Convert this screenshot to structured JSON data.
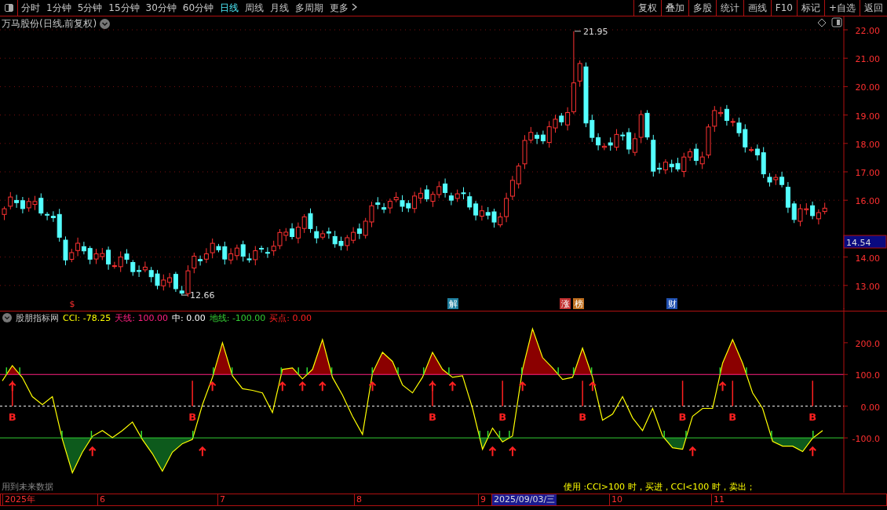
{
  "toolbar": {
    "periods": [
      {
        "label": "分时",
        "selected": false
      },
      {
        "label": "1分钟",
        "selected": false
      },
      {
        "label": "5分钟",
        "selected": false
      },
      {
        "label": "15分钟",
        "selected": false
      },
      {
        "label": "30分钟",
        "selected": false
      },
      {
        "label": "60分钟",
        "selected": false
      },
      {
        "label": "日线",
        "selected": true
      },
      {
        "label": "周线",
        "selected": false
      },
      {
        "label": "月线",
        "selected": false
      },
      {
        "label": "多周期",
        "selected": false
      },
      {
        "label": "更多",
        "selected": false
      }
    ],
    "buttons": [
      "复权",
      "叠加",
      "多股",
      "统计",
      "画线",
      "F10",
      "标记",
      "+自选",
      "返回"
    ]
  },
  "price_panel": {
    "title": "万马股份(日线,前复权)",
    "high_label": "21.95",
    "low_label": "12.66",
    "events": [
      {
        "text": "$"
      },
      {
        "text": "解",
        "color": "#1f7f9f"
      },
      {
        "text": "涨",
        "color": "#c03030"
      },
      {
        "text": "榜",
        "color": "#c07020"
      },
      {
        "text": "财",
        "color": "#2050b0"
      }
    ],
    "axis_labels": [
      "22.00",
      "21.00",
      "20.00",
      "19.00",
      "18.00",
      "17.00",
      "16.00",
      "14.00",
      "13.00"
    ],
    "last_price": "14.54"
  },
  "indicator_panel": {
    "name": "股朋指标网",
    "legend": [
      {
        "label": "CCI: -78.25",
        "color": "#ffff00"
      },
      {
        "label": "天线: 100.00",
        "color": "#ff2080"
      },
      {
        "label": "中: 0.00",
        "color": "#ffffff"
      },
      {
        "label": "地线: -100.00",
        "color": "#33cc33"
      },
      {
        "label": "买点: 0.00",
        "color": "#ff2020"
      }
    ],
    "axis_labels": [
      "200.0",
      "100.0",
      "0.00",
      "-100.0"
    ],
    "signal_labels": [
      "B",
      "B",
      "B",
      "B",
      "B",
      "B",
      "B",
      "B"
    ],
    "note": "用到未来数据",
    "usage": "使用 :CCI>100 时，买进，CCI<100 时，卖出；"
  },
  "date_axis": [
    {
      "label": "2025年",
      "selected": false
    },
    {
      "label": "6",
      "selected": false
    },
    {
      "label": "7",
      "selected": false
    },
    {
      "label": "8",
      "selected": false
    },
    {
      "label": "9",
      "selected": false
    },
    {
      "label": "2025/09/03/三",
      "selected": true
    },
    {
      "label": "10",
      "selected": false
    },
    {
      "label": "11",
      "selected": false
    }
  ]
}
